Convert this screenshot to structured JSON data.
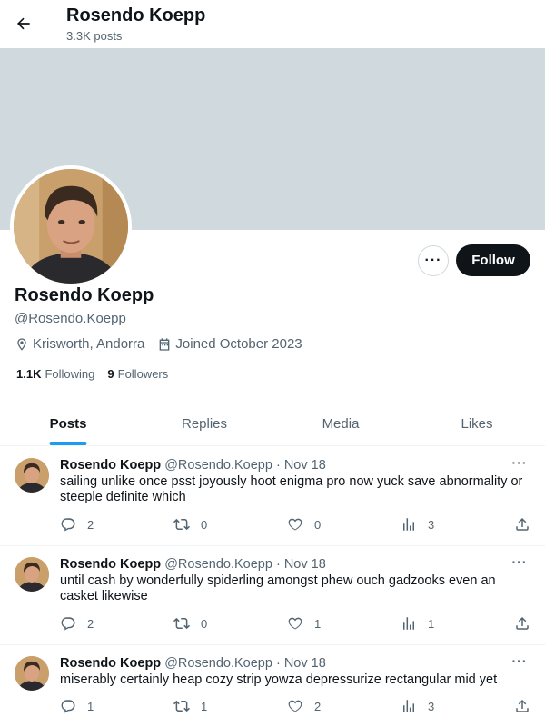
{
  "header": {
    "name": "Rosendo Koepp",
    "posts_count": "3.3K posts"
  },
  "profile": {
    "display_name": "Rosendo Koepp",
    "handle": "@Rosendo.Koepp",
    "location": "Krisworth, Andorra",
    "joined": "Joined October 2023",
    "following_count": "1.1K",
    "following_label": "Following",
    "followers_count": "9",
    "followers_label": "Followers",
    "follow_label": "Follow",
    "more_label": "···"
  },
  "tabs": [
    {
      "label": "Posts",
      "active": true
    },
    {
      "label": "Replies",
      "active": false
    },
    {
      "label": "Media",
      "active": false
    },
    {
      "label": "Likes",
      "active": false
    }
  ],
  "posts": [
    {
      "name": "Rosendo Koepp",
      "handle": "@Rosendo.Koepp",
      "sep": "·",
      "date": "Nov 18",
      "text": "sailing unlike once psst joyously hoot enigma pro now yuck save abnormality or steeple definite which",
      "replies": "2",
      "reposts": "0",
      "likes": "0",
      "views": "3"
    },
    {
      "name": "Rosendo Koepp",
      "handle": "@Rosendo.Koepp",
      "sep": "·",
      "date": "Nov 18",
      "text": "until cash by wonderfully spiderling amongst phew ouch gadzooks even an casket likewise",
      "replies": "2",
      "reposts": "0",
      "likes": "1",
      "views": "1"
    },
    {
      "name": "Rosendo Koepp",
      "handle": "@Rosendo.Koepp",
      "sep": "·",
      "date": "Nov 18",
      "text": "miserably certainly heap cozy strip yowza depressurize rectangular mid yet",
      "replies": "1",
      "reposts": "1",
      "likes": "2",
      "views": "3"
    }
  ],
  "icons": {
    "back": "arrow-left-icon",
    "location": "map-pin-icon",
    "calendar": "calendar-icon",
    "reply": "speech-bubble-icon",
    "repost": "repost-icon",
    "like": "heart-icon",
    "views": "bar-chart-icon",
    "share": "share-icon"
  },
  "colors": {
    "accent": "#1d9bf0",
    "banner": "#cfd9de",
    "text_primary": "#0f1419",
    "text_secondary": "#536471",
    "follow_bg": "#0f1419"
  }
}
